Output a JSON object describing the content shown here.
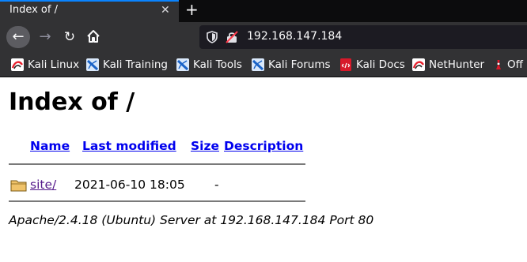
{
  "browser": {
    "tab": {
      "title": "Index of /",
      "close_glyph": "✕"
    },
    "new_tab_glyph": "+",
    "nav": {
      "back_glyph": "←",
      "forward_glyph": "→",
      "reload_glyph": "↻"
    },
    "url": "192.168.147.184",
    "bookmarks": [
      {
        "label": "Kali Linux",
        "icon": "kali-dragon-icon"
      },
      {
        "label": "Kali Training",
        "icon": "kali-training-icon"
      },
      {
        "label": "Kali Tools",
        "icon": "kali-training-icon"
      },
      {
        "label": "Kali Forums",
        "icon": "kali-training-icon"
      },
      {
        "label": "Kali Docs",
        "icon": "kali-docs-icon"
      },
      {
        "label": "NetHunter",
        "icon": "kali-dragon-icon"
      },
      {
        "label": "Off",
        "icon": "offsec-icon"
      }
    ]
  },
  "page": {
    "heading": "Index of /",
    "columns": {
      "name": "Name",
      "last_modified": "Last modified",
      "size": "Size",
      "description": "Description"
    },
    "rows": [
      {
        "icon": "folder-icon",
        "name": "site/",
        "last_modified": "2021-06-10 18:05",
        "size": "-",
        "description": ""
      }
    ],
    "footer": "Apache/2.4.18 (Ubuntu) Server at 192.168.147.184 Port 80"
  },
  "colors": {
    "link": "#0000ee",
    "visited_link": "#551a8b",
    "chrome_dark": "#0c0c0d",
    "chrome": "#323234",
    "tab_accent": "#0a84ff"
  }
}
